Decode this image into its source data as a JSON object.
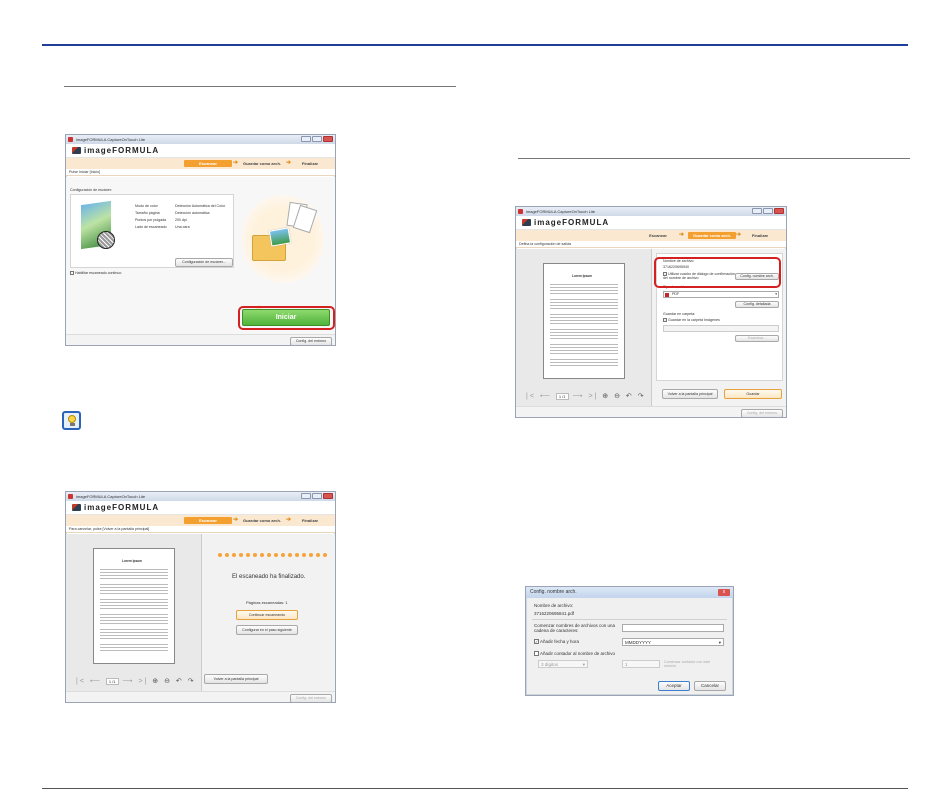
{
  "screen1": {
    "title": "imageFORMULA CaptureOnTouch Lite",
    "logo": "imageFORMULA",
    "steps": [
      "Escanear",
      "Guardar como arch.",
      "Finalizar"
    ],
    "instruction": "Pulse Iniciar [Inicio]",
    "config_heading": "Configuración de escáner:",
    "settings": [
      {
        "label": "Modo de color",
        "value": "Detección Automática del Color"
      },
      {
        "label": "Tamaño página",
        "value": "Detección automática"
      },
      {
        "label": "Puntos por pulgada",
        "value": "200 dpi"
      },
      {
        "label": "Lado de escaneado",
        "value": "Una cara"
      }
    ],
    "config_button": "Configuración de escáner...",
    "continuous_checkbox": "Habilitar escaneado continuo",
    "start_button": "Iniciar",
    "env_button": "Config. del entorno"
  },
  "screen2": {
    "title": "imageFORMULA CaptureOnTouch Lite",
    "logo": "imageFORMULA",
    "steps": [
      "Escanear",
      "Guardar como arch.",
      "Finalizar"
    ],
    "instruction": "Para cancelar, pulse [Volver a la pantalla principal]",
    "finished_text": "El escaneado ha finalizado.",
    "pages_scanned_label": "Páginas escaneadas:",
    "pages_scanned_value": "1",
    "continue_button": "Continuar escaneando",
    "next_button": "Configurar en el paso siguiente",
    "back_button": "Volver a la pantalla principal",
    "env_button": "Config. del entorno",
    "page_input": "1 /1",
    "doc_title": "Lorem Ipsum"
  },
  "screen3": {
    "title": "imageFORMULA CaptureOnTouch Lite",
    "logo": "imageFORMULA",
    "steps": [
      "Escanear",
      "Guardar como arch.",
      "Finalizar"
    ],
    "instruction": "Defina la configuración de salida",
    "filename_label": "Nombre de archivo:",
    "filename_value": "3716220695940",
    "dialog_checkbox": "Utilizar cuadro de diálogo de confirmación del nombre de archivo",
    "filename_button": "Config. nombre arch.",
    "filetype_label": "Tipo de archivo:",
    "filetype_value": "PDF",
    "detail_button": "Config. detallada",
    "save_in_label": "Guardar en carpeta:",
    "save_in_checkbox": "Guardar en la carpeta Imágenes",
    "browse_button": "Examinar...",
    "back_button": "Volver a la pantalla principal",
    "save_button": "Guardar",
    "env_button": "Config. del entorno",
    "page_input": "1 /1",
    "doc_title": "Lorem Ipsum"
  },
  "dialog": {
    "title": "Config. nombre arch.",
    "filename_label": "Nombre de archivo:",
    "filename_value": "3716220695841.pdf",
    "prefix_label": "Comenzar nombres de archivos con una cadena de caracteres:",
    "prefix_value": "",
    "date_checkbox": "Añadir fecha y hora",
    "date_format": "MMDDYYYY",
    "counter_checkbox": "Añadir contador al nombre de archivo",
    "digits_value": "3 dígitos",
    "counter_start": "1",
    "counter_hint": "Comenzar contador con este número",
    "ok_button": "Aceptar",
    "cancel_button": "Cancelar"
  }
}
